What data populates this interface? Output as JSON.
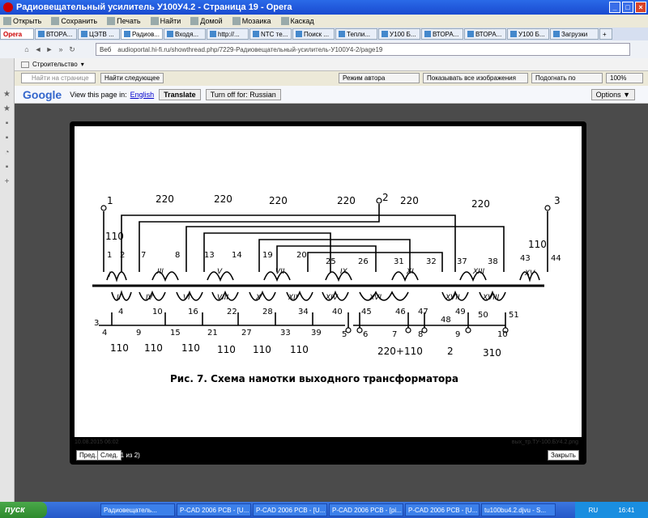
{
  "window": {
    "title": "Радиовещательный усилитель У100У4.2 - Страница 19 - Opera"
  },
  "menu": [
    "Открыть",
    "Сохранить",
    "Печать",
    "Найти",
    "Домой",
    "Мозаика",
    "Каскад"
  ],
  "tabs": [
    "Opera",
    "ВТОРА...",
    "ЦЭТВ ...",
    "Радиов...",
    "Входя...",
    "http://...",
    "NTC те...",
    "Поиск ...",
    "Тепли...",
    "У100 Б...",
    "ВТОРА...",
    "ВТОРА...",
    "У100 Б...",
    "Загрузки"
  ],
  "address": {
    "label": "Веб",
    "url": "audioportal.hi-fi.ru/showthread.php/7229-Радиовещательный-усилитель-У100У4-2/page19"
  },
  "bookmarks": {
    "folder": "Строительство"
  },
  "findbar": {
    "placeholder": "Найти на странице",
    "next": "Найти следующее",
    "mode": "Режим автора",
    "images": "Показывать все изображения",
    "fit": "Подогнать по ширине",
    "zoom": "100%"
  },
  "translate": {
    "logo": "Google",
    "view": "View this page in:",
    "lang": "English",
    "translate_btn": "Translate",
    "turn_off": "Turn off for: Russian",
    "options": "Options ▼"
  },
  "lightbox": {
    "date": "10.08.2015 06:02",
    "filename": "вых_тр.ТУ-100.БУ4.2.png",
    "prev": "Пред.",
    "next": "След.",
    "count": "(1 из 2)",
    "close": "Закрыть"
  },
  "figure": {
    "caption": "Рис. 7. Схема намотки выходного трансформатора",
    "top_voltages": [
      "220",
      "220",
      "220",
      "220",
      "220",
      "220"
    ],
    "left_voltage": "110",
    "right_voltage": "110",
    "terminals_top": [
      "1",
      "2",
      "3"
    ],
    "roman": [
      "I",
      "III",
      "V",
      "VII",
      "IX",
      "XI",
      "XIII",
      "XV",
      "II",
      "IV",
      "VI",
      "VIII",
      "X",
      "XII",
      "XIV",
      "XVI",
      "XVII",
      "XVIII"
    ],
    "bottom_voltages": [
      "110",
      "110",
      "110",
      "110",
      "110",
      "110",
      "220+110",
      "2",
      "310"
    ]
  },
  "taskbar": {
    "start": "пуск",
    "items": [
      "Радиовещатель...",
      "P-CAD 2006 PCB - [U...",
      "P-CAD 2006 PCB - [U...",
      "P-CAD 2006 PCB - [pi...",
      "P-CAD 2006 PCB - [U...",
      "tu100bu4.2.djvu - S..."
    ],
    "lang": "RU",
    "time": "16:41"
  }
}
